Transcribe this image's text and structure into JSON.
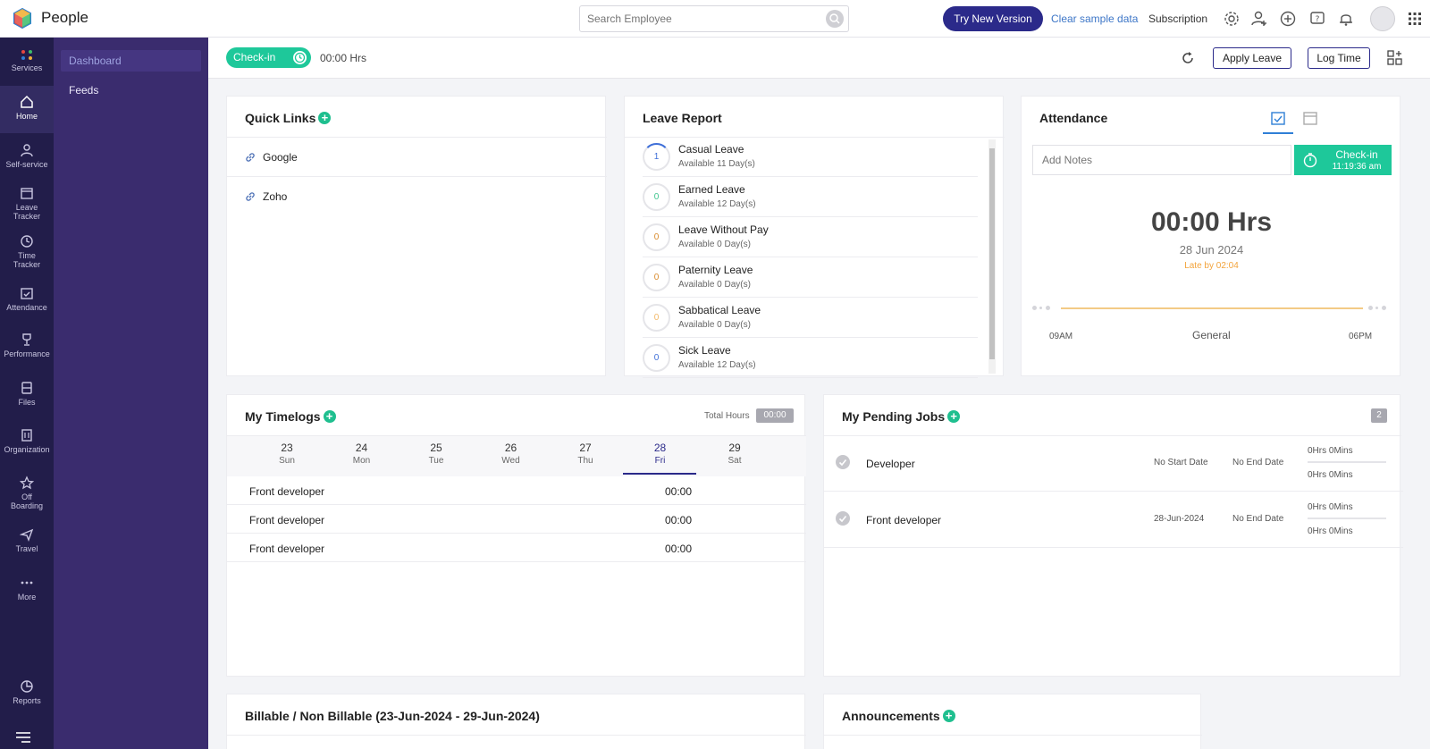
{
  "app": {
    "title": "People"
  },
  "header": {
    "search_placeholder": "Search Employee",
    "try_new_version": "Try New Version",
    "clear_sample_data": "Clear sample data",
    "subscription": "Subscription",
    "icons": [
      "gear-icon",
      "user-add-icon",
      "plus-circle-icon",
      "help-icon",
      "bell-icon",
      "avatar",
      "grid-icon"
    ]
  },
  "leftnav": {
    "items": [
      {
        "label": "Services",
        "icon": "services-dots-icon"
      },
      {
        "label": "Home",
        "icon": "home-icon",
        "active": true
      },
      {
        "label": "Self-service",
        "icon": "user-icon"
      },
      {
        "label": "Leave Tracker",
        "icon": "calendar-icon"
      },
      {
        "label": "Time Tracker",
        "icon": "clock-icon"
      },
      {
        "label": "Attendance",
        "icon": "calendar-check-icon"
      },
      {
        "label": "Performance",
        "icon": "trophy-icon"
      },
      {
        "label": "Files",
        "icon": "files-icon"
      },
      {
        "label": "Organization",
        "icon": "building-icon"
      },
      {
        "label": "Off Boarding",
        "icon": "star-icon"
      },
      {
        "label": "Travel",
        "icon": "plane-icon"
      },
      {
        "label": "More",
        "icon": "more-icon"
      },
      {
        "label": "Reports",
        "icon": "chart-icon"
      }
    ]
  },
  "subnav": {
    "items": [
      {
        "label": "Dashboard",
        "active": true
      },
      {
        "label": "Feeds"
      }
    ]
  },
  "toolbar": {
    "checkin_label": "Check-in",
    "hours": "00:00 Hrs",
    "apply_leave": "Apply Leave",
    "log_time": "Log Time"
  },
  "quick_links": {
    "title": "Quick Links",
    "items": [
      "Google",
      "Zoho"
    ]
  },
  "leave_report": {
    "title": "Leave Report",
    "items": [
      {
        "count": "1",
        "name": "Casual Leave",
        "available": "Available 11 Day(s)",
        "color": "#3f6fd8"
      },
      {
        "count": "0",
        "name": "Earned Leave",
        "available": "Available 12 Day(s)",
        "color": "#3ec58e"
      },
      {
        "count": "0",
        "name": "Leave Without Pay",
        "available": "Available 0 Day(s)",
        "color": "#d98b2c"
      },
      {
        "count": "0",
        "name": "Paternity Leave",
        "available": "Available 0 Day(s)",
        "color": "#d98b2c"
      },
      {
        "count": "0",
        "name": "Sabbatical Leave",
        "available": "Available 0 Day(s)",
        "color": "#f2b867"
      },
      {
        "count": "0",
        "name": "Sick Leave",
        "available": "Available 12 Day(s)",
        "color": "#3f6fd8"
      }
    ]
  },
  "attendance": {
    "title": "Attendance",
    "notes_placeholder": "Add Notes",
    "checkin_label": "Check-in",
    "checkin_time": "11:19:36 am",
    "hours": "00:00 Hrs",
    "date": "28 Jun 2024",
    "late": "Late by 02:04",
    "start": "09AM",
    "shift": "General",
    "end": "06PM"
  },
  "timelogs": {
    "title": "My Timelogs",
    "total_hours_label": "Total Hours",
    "total_hours": "00:00",
    "days": [
      {
        "d": "23",
        "w": "Sun"
      },
      {
        "d": "24",
        "w": "Mon"
      },
      {
        "d": "25",
        "w": "Tue"
      },
      {
        "d": "26",
        "w": "Wed"
      },
      {
        "d": "27",
        "w": "Thu"
      },
      {
        "d": "28",
        "w": "Fri",
        "active": true
      },
      {
        "d": "29",
        "w": "Sat"
      }
    ],
    "rows": [
      {
        "name": "Front developer",
        "time": "00:00"
      },
      {
        "name": "Front developer",
        "time": "00:00"
      },
      {
        "name": "Front developer",
        "time": "00:00"
      }
    ]
  },
  "pending_jobs": {
    "title": "My Pending Jobs",
    "count": "2",
    "rows": [
      {
        "name": "Developer",
        "start": "No Start Date",
        "end": "No End Date",
        "h1": "0Hrs 0Mins",
        "h2": "0Hrs 0Mins"
      },
      {
        "name": "Front developer",
        "start": "28-Jun-2024",
        "end": "No End Date",
        "h1": "0Hrs 0Mins",
        "h2": "0Hrs 0Mins"
      }
    ]
  },
  "billable": {
    "title": "Billable / Non Billable (23-Jun-2024 - 29-Jun-2024)"
  },
  "announcements": {
    "title": "Announcements"
  },
  "colors": {
    "accent": "#2b2a8a",
    "green": "#1ec89a",
    "nav_bg": "#221d4a",
    "subnav_bg": "#3a2c6e"
  }
}
